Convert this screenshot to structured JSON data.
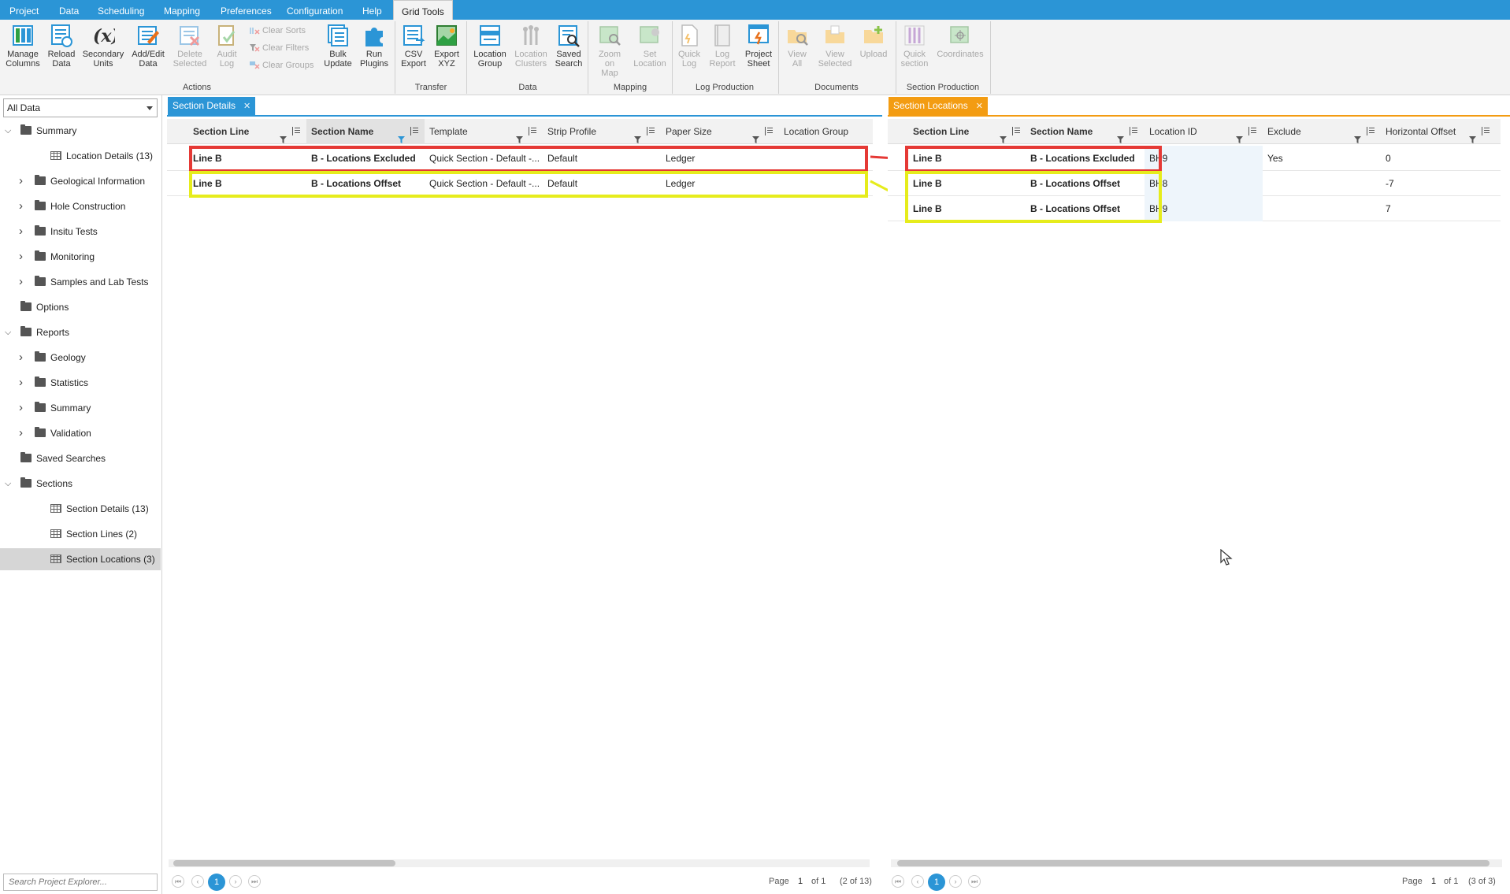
{
  "menu": {
    "items": [
      "Project",
      "Data",
      "Scheduling",
      "Mapping",
      "Preferences",
      "Configuration",
      "Help"
    ],
    "active": "Grid Tools"
  },
  "ribbon": {
    "actions": {
      "manage_columns": "Manage Columns",
      "reload_data": "Reload Data",
      "secondary_units": "Secondary Units",
      "add_edit_data": "Add/Edit Data",
      "delete_selected": "Delete Selected",
      "audit_log": "Audit Log",
      "clear_sorts": "Clear Sorts",
      "clear_filters": "Clear Filters",
      "clear_groups": "Clear Groups",
      "bulk_update": "Bulk Update",
      "run_plugins": "Run Plugins",
      "label": "Actions"
    },
    "transfer": {
      "csv_export": "CSV Export",
      "export_xyz": "Export XYZ",
      "label": "Transfer"
    },
    "data": {
      "location_group": "Location Group",
      "location_clusters": "Location Clusters",
      "saved_search": "Saved Search",
      "label": "Data"
    },
    "mapping": {
      "zoom_on_map": "Zoom on Map",
      "set_location": "Set Location",
      "label": "Mapping"
    },
    "log_production": {
      "quick_log": "Quick Log",
      "log_report": "Log Report",
      "project_sheet": "Project Sheet",
      "label": "Log Production"
    },
    "documents": {
      "view_all": "View All",
      "view_selected": "View Selected",
      "upload": "Upload",
      "label": "Documents"
    },
    "section_production": {
      "quick_section": "Quick section",
      "coordinates": "Coordinates",
      "label": "Section Production"
    }
  },
  "explorer": {
    "filter": "All Data",
    "search_placeholder": "Search Project Explorer...",
    "tree": [
      {
        "label": "Summary",
        "level": 0,
        "type": "folder",
        "state": "expanded"
      },
      {
        "label": "Location Details (13)",
        "level": 1,
        "type": "grid",
        "state": "leaf"
      },
      {
        "label": "Geological Information",
        "level": 1,
        "type": "folder",
        "state": "collapsed"
      },
      {
        "label": "Hole Construction",
        "level": 1,
        "type": "folder",
        "state": "collapsed"
      },
      {
        "label": "Insitu Tests",
        "level": 1,
        "type": "folder",
        "state": "collapsed"
      },
      {
        "label": "Monitoring",
        "level": 1,
        "type": "folder",
        "state": "collapsed"
      },
      {
        "label": "Samples and Lab Tests",
        "level": 1,
        "type": "folder",
        "state": "collapsed"
      },
      {
        "label": "Options",
        "level": 0,
        "type": "folder",
        "state": "leaf"
      },
      {
        "label": "Reports",
        "level": 0,
        "type": "folder",
        "state": "expanded"
      },
      {
        "label": "Geology",
        "level": 1,
        "type": "folder",
        "state": "collapsed"
      },
      {
        "label": "Statistics",
        "level": 1,
        "type": "folder",
        "state": "collapsed"
      },
      {
        "label": "Summary",
        "level": 1,
        "type": "folder",
        "state": "collapsed"
      },
      {
        "label": "Validation",
        "level": 1,
        "type": "folder",
        "state": "collapsed"
      },
      {
        "label": "Saved Searches",
        "level": 0,
        "type": "folder",
        "state": "leaf"
      },
      {
        "label": "Sections",
        "level": 0,
        "type": "folder",
        "state": "expanded"
      },
      {
        "label": "Section Details (13)",
        "level": 1,
        "type": "grid",
        "state": "leaf"
      },
      {
        "label": "Section Lines (2)",
        "level": 1,
        "type": "grid",
        "state": "leaf"
      },
      {
        "label": "Section Locations (3)",
        "level": 1,
        "type": "grid",
        "state": "selected"
      }
    ]
  },
  "left_panel": {
    "tab": "Section Details",
    "columns": [
      "Section Line",
      "Section Name",
      "Template",
      "Strip Profile",
      "Paper Size",
      "Location Group"
    ],
    "rows": [
      [
        "Line B",
        "B - Locations Excluded",
        "Quick Section - Default -...",
        "Default",
        "Ledger",
        ""
      ],
      [
        "Line B",
        "B - Locations Offset",
        "Quick Section - Default -...",
        "Default",
        "Ledger",
        ""
      ]
    ],
    "pager": {
      "page_label": "Page",
      "page": "1",
      "of": "of 1",
      "count": "(2 of 13)",
      "current": "1"
    }
  },
  "right_panel": {
    "tab": "Section Locations",
    "columns": [
      "Section Line",
      "Section Name",
      "Location ID",
      "Exclude",
      "Horizontal Offset"
    ],
    "rows": [
      [
        "Line B",
        "B - Locations Excluded",
        "BH9",
        "Yes",
        "0"
      ],
      [
        "Line B",
        "B - Locations Offset",
        "BH8",
        "",
        "-7"
      ],
      [
        "Line B",
        "B - Locations Offset",
        "BH9",
        "",
        "7"
      ]
    ],
    "pager": {
      "page_label": "Page",
      "page": "1",
      "of": "of 1",
      "count": "(3 of 3)",
      "current": "1"
    }
  },
  "colors": {
    "accent": "#2b95d6",
    "orange_tab": "#f39c12",
    "red_highlight": "#e53935",
    "yellow_highlight": "#e6ec1c"
  }
}
